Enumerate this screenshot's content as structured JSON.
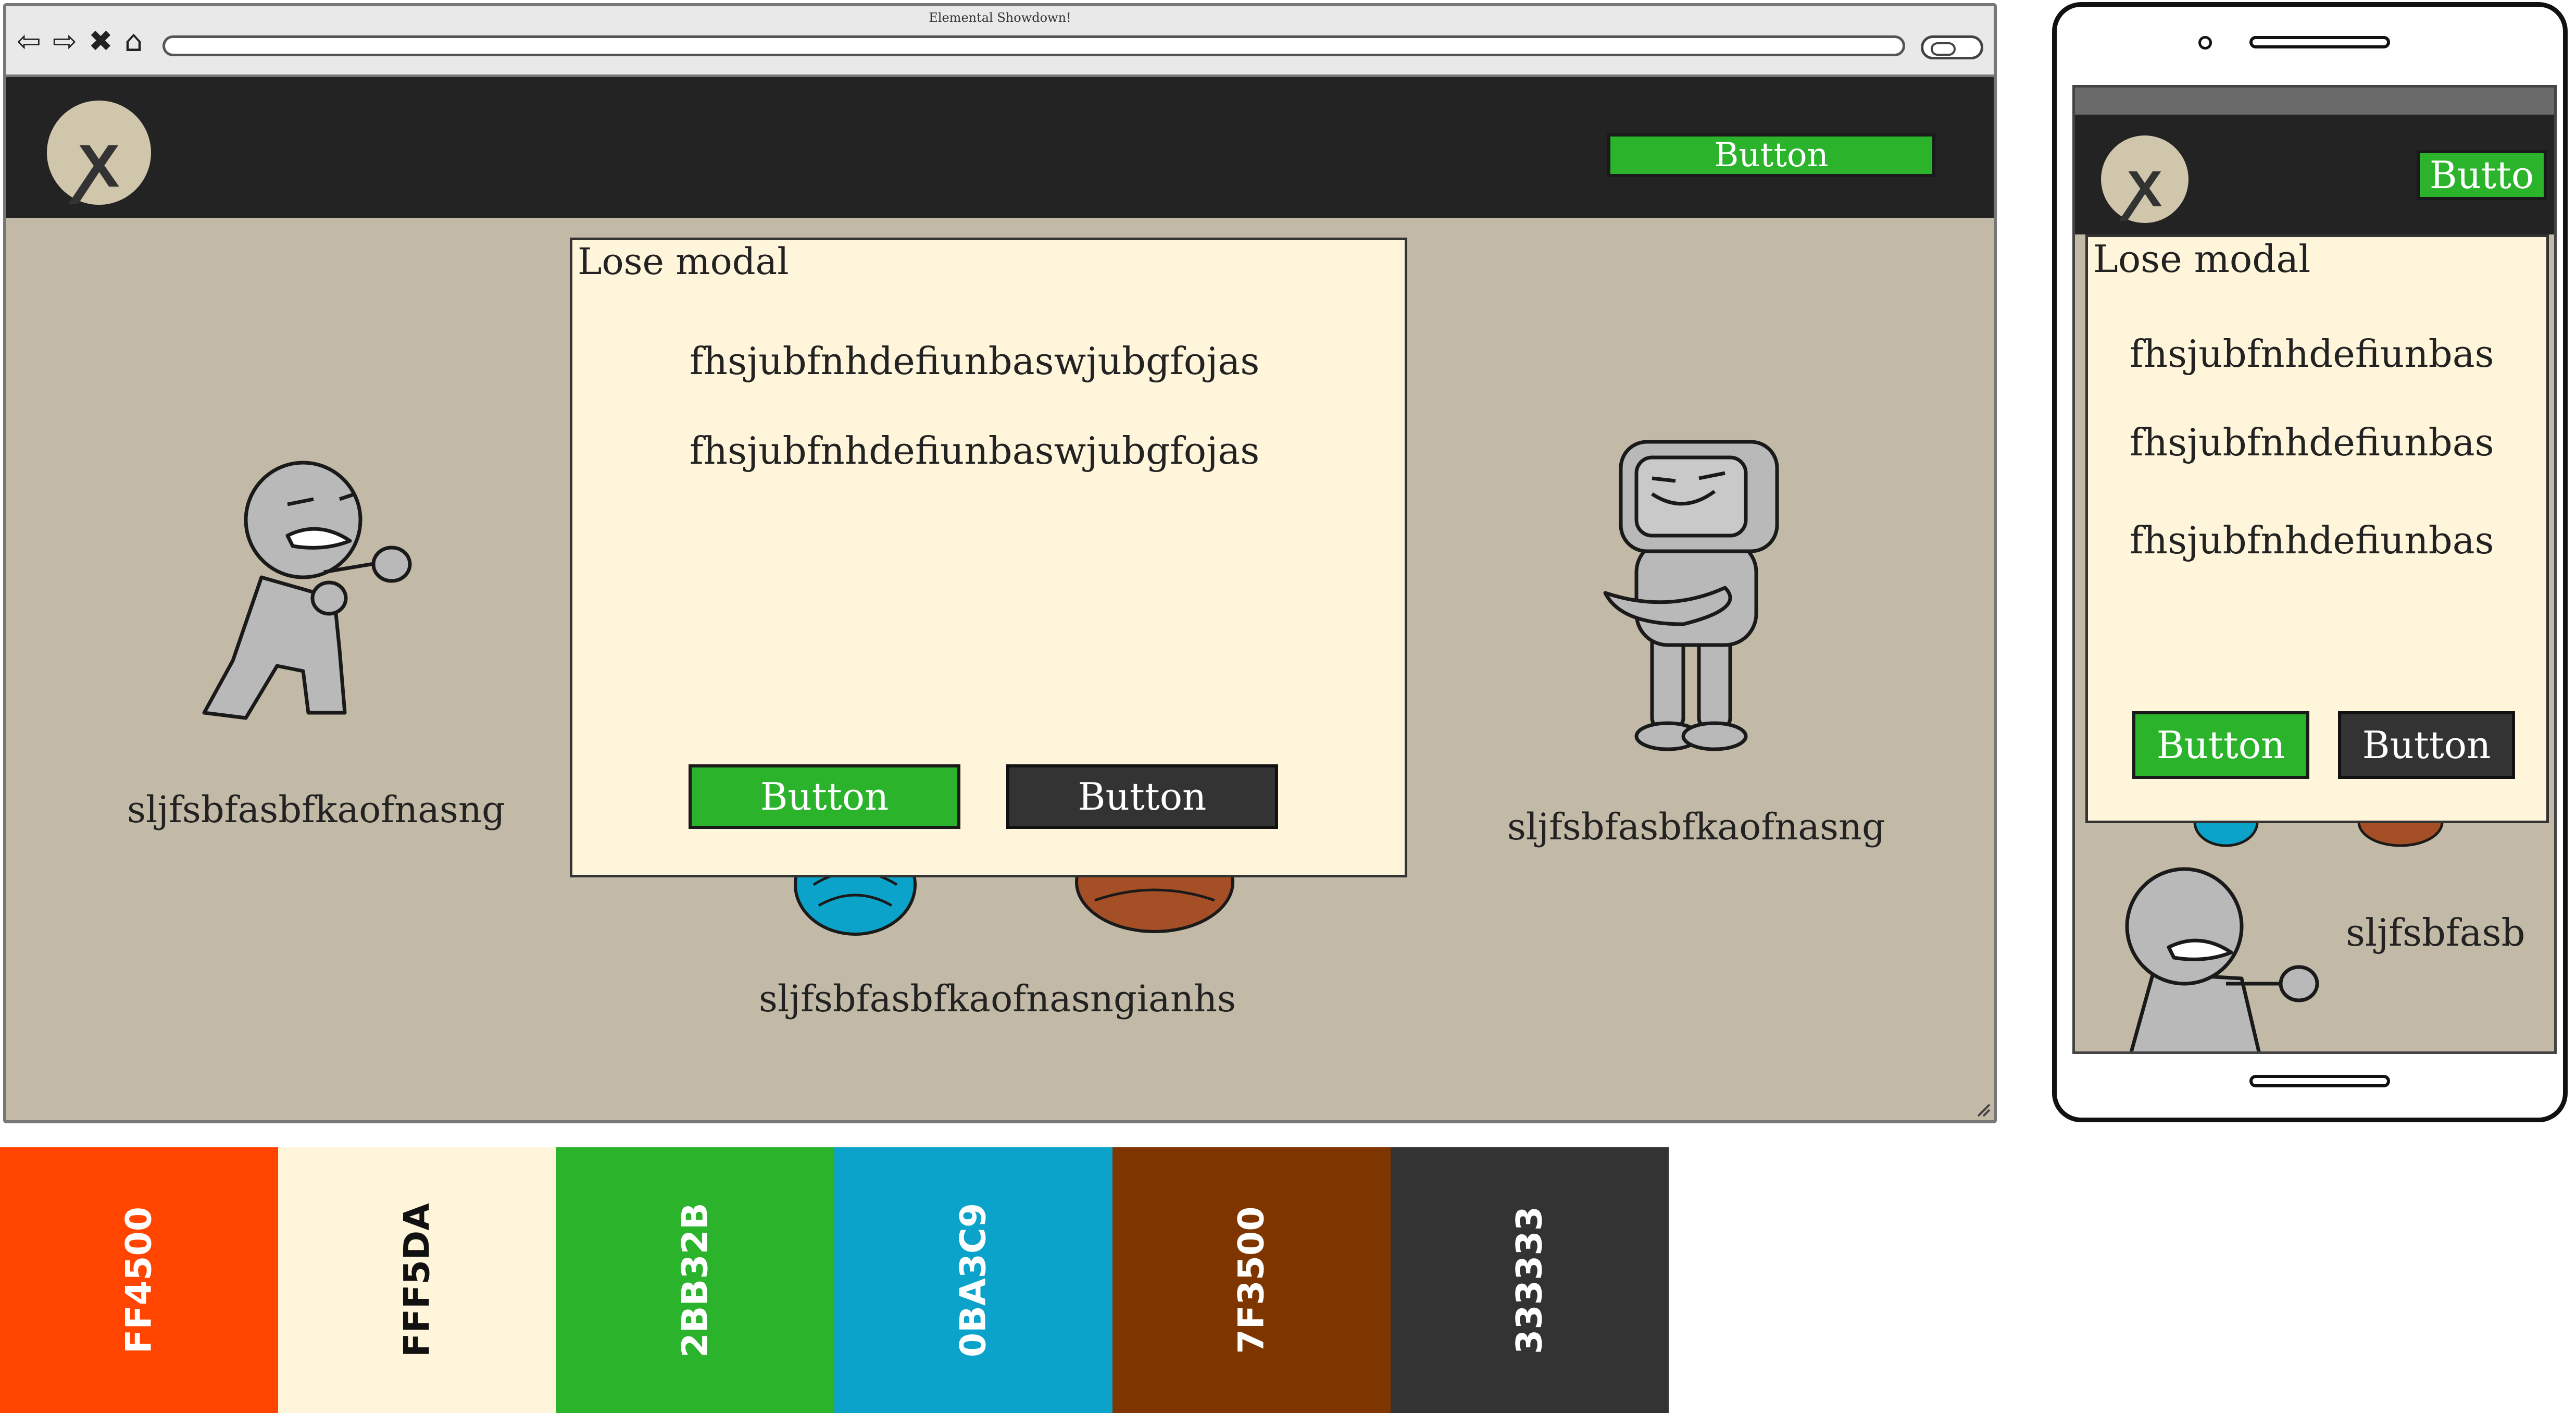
{
  "browser": {
    "title": "Elemental Showdown!",
    "header_button": "Button",
    "modal": {
      "title": "Lose modal",
      "lines": [
        "fhsjubfnhdefiunbaswjubgfojas",
        "fhsjubfnhdefiunbaswjubgfojas"
      ],
      "primary_button": "Button",
      "secondary_button": "Button"
    },
    "left_label": "sljfsbfasbfkaofnasng",
    "right_label": "sljfsbfasbfkaofnasng",
    "center_label": "sljfsbfasbfkaofnasngianhs"
  },
  "mobile": {
    "header_button": "Butto",
    "modal": {
      "title": "Lose modal",
      "lines": [
        "fhsjubfnhdefiunbas",
        "fhsjubfnhdefiunbas",
        "fhsjubfnhdefiunbas"
      ],
      "primary_button": "Button",
      "secondary_button": "Button"
    },
    "label": "sljfsbfasb"
  },
  "palette": [
    {
      "label": "FF4500",
      "color": "#FF4500",
      "text_color": "#ffffff"
    },
    {
      "label": "FFF5DA",
      "color": "#FFF5DA",
      "text_color": "#111111"
    },
    {
      "label": "2BB32B",
      "color": "#2BB32B",
      "text_color": "#ffffff"
    },
    {
      "label": "0BA3C9",
      "color": "#0BA3C9",
      "text_color": "#ffffff"
    },
    {
      "label": "7F3500",
      "color": "#7F3500",
      "text_color": "#ffffff"
    },
    {
      "label": "333333",
      "color": "#333333",
      "text_color": "#ffffff"
    }
  ],
  "icons": {
    "logo": "xing-logo-icon",
    "nav": [
      "back-arrow-icon",
      "forward-arrow-icon",
      "close-icon",
      "home-icon"
    ]
  }
}
